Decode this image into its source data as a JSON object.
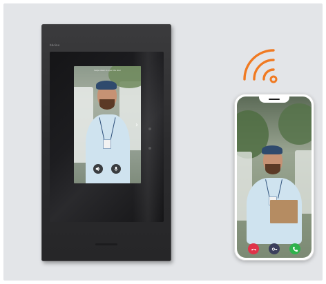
{
  "monitor": {
    "brand": "bticino",
    "caption": "Swipe down to open the door",
    "controls": {
      "speaker_icon": "speaker-icon",
      "mic_icon": "microphone-icon",
      "next_icon": "chevron-right-icon"
    }
  },
  "connection": {
    "icon": "wifi-icon",
    "color": "#f07a22"
  },
  "phone": {
    "call_buttons": [
      {
        "name": "decline-call",
        "icon": "phone-hangup-icon",
        "color": "#e0334a"
      },
      {
        "name": "open-door",
        "icon": "key-icon",
        "color": "#3b3f5c"
      },
      {
        "name": "answer-call",
        "icon": "phone-icon",
        "color": "#2fb24c"
      }
    ]
  }
}
